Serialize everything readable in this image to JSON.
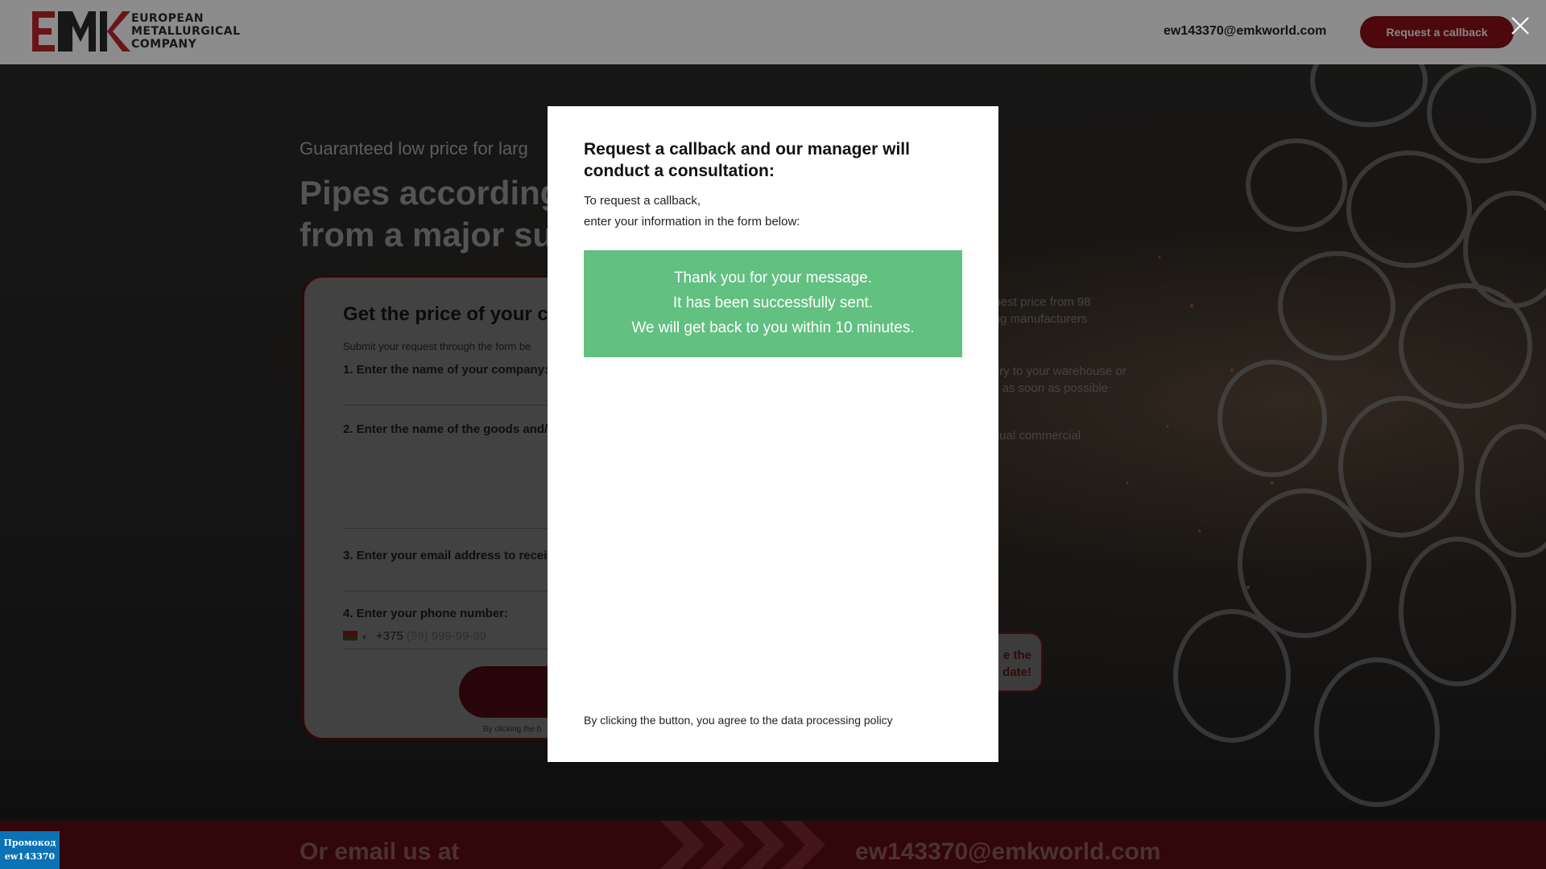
{
  "header": {
    "logo_line1": "EUROPEAN",
    "logo_line2": "METALLURGICAL",
    "logo_line3": "COMPANY",
    "email": "ew143370@emkworld.com",
    "callback_button": "Request a callback"
  },
  "hero": {
    "tagline": "Guaranteed low price for larg",
    "title_line1": "Pipes according",
    "title_line2": "from a major su"
  },
  "form": {
    "title": "Get the price of your c",
    "subtitle": "Submit your request through the form be",
    "label1": "1. Enter the name of your company:",
    "label2": "2. Enter the name of the goods and/c",
    "label3": "3. Enter your email address to receiv",
    "label4": "4. Enter your phone number:",
    "phone_code": "+375",
    "phone_placeholder": "(99) 999-99-99",
    "note": "By clicking the b"
  },
  "benefits": [
    {
      "line1": "e best price from 98",
      "line2": "ding manufacturers"
    },
    {
      "line1": "ivery to your warehouse or",
      "line2": "lity as soon as possible"
    },
    {
      "line1": "vidual commercial",
      "line2": "er"
    }
  ],
  "deadline": {
    "line1": "e the",
    "line2": "date!"
  },
  "bottom": {
    "left": "Or email us at",
    "right": "ew143370@emkworld.com"
  },
  "promo": {
    "line1": "Промокод",
    "line2": "ew143370"
  },
  "modal": {
    "title": "Request a callback and our manager will conduct a consultation:",
    "desc_line1": "To request a callback,",
    "desc_line2": "enter your information in the form below:",
    "success_line1": "Thank you for your message.",
    "success_line2": "It has been successfully sent.",
    "success_line3": "We will get back to you within 10 minutes.",
    "note": "By clicking the button, you agree to the data processing policy"
  },
  "colors": {
    "brand_red": "#8a1019",
    "success_green": "#62c081",
    "promo_blue": "#0a72b5"
  },
  "icons": {
    "close": "close-icon",
    "chevron": "chevron-down-icon"
  }
}
